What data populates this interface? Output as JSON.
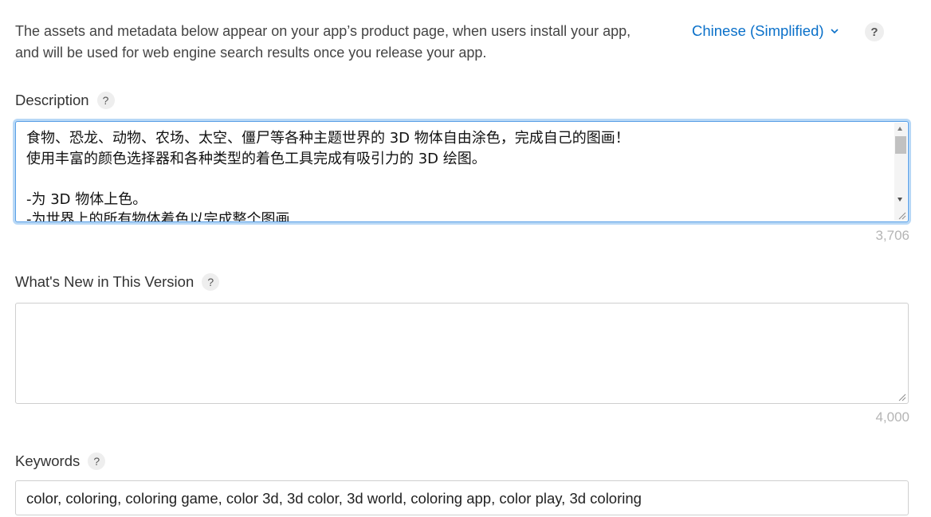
{
  "intro_text": "The assets and metadata below appear on your app’s product page, when users install your app, and will be used for web engine search results once you release your app.",
  "language_selector": {
    "value": "Chinese (Simplified)",
    "icon": "chevron-down-icon"
  },
  "help_symbol": "?",
  "description": {
    "label": "Description",
    "text": "食物、恐龙、动物、农场、太空、僵尸等各种主题世界的 3D 物体自由涂色，完成自己的图画！\n使用丰富的颜色选择器和各种类型的着色工具完成有吸引力的 3D 绘图。\n\n-为 3D 物体上色。\n-为世界上的所有物体着色以完成整个图画",
    "remaining_chars": "3,706"
  },
  "whats_new": {
    "label": "What's New in This Version",
    "text": "",
    "remaining_chars": "4,000"
  },
  "keywords": {
    "label": "Keywords",
    "value": "color, coloring, coloring game, color 3d, 3d color, 3d world, coloring app, color play, 3d coloring"
  },
  "colors": {
    "link": "#0a70c9",
    "focus_border": "#5aa0e6",
    "counter": "#b5b5b5"
  }
}
